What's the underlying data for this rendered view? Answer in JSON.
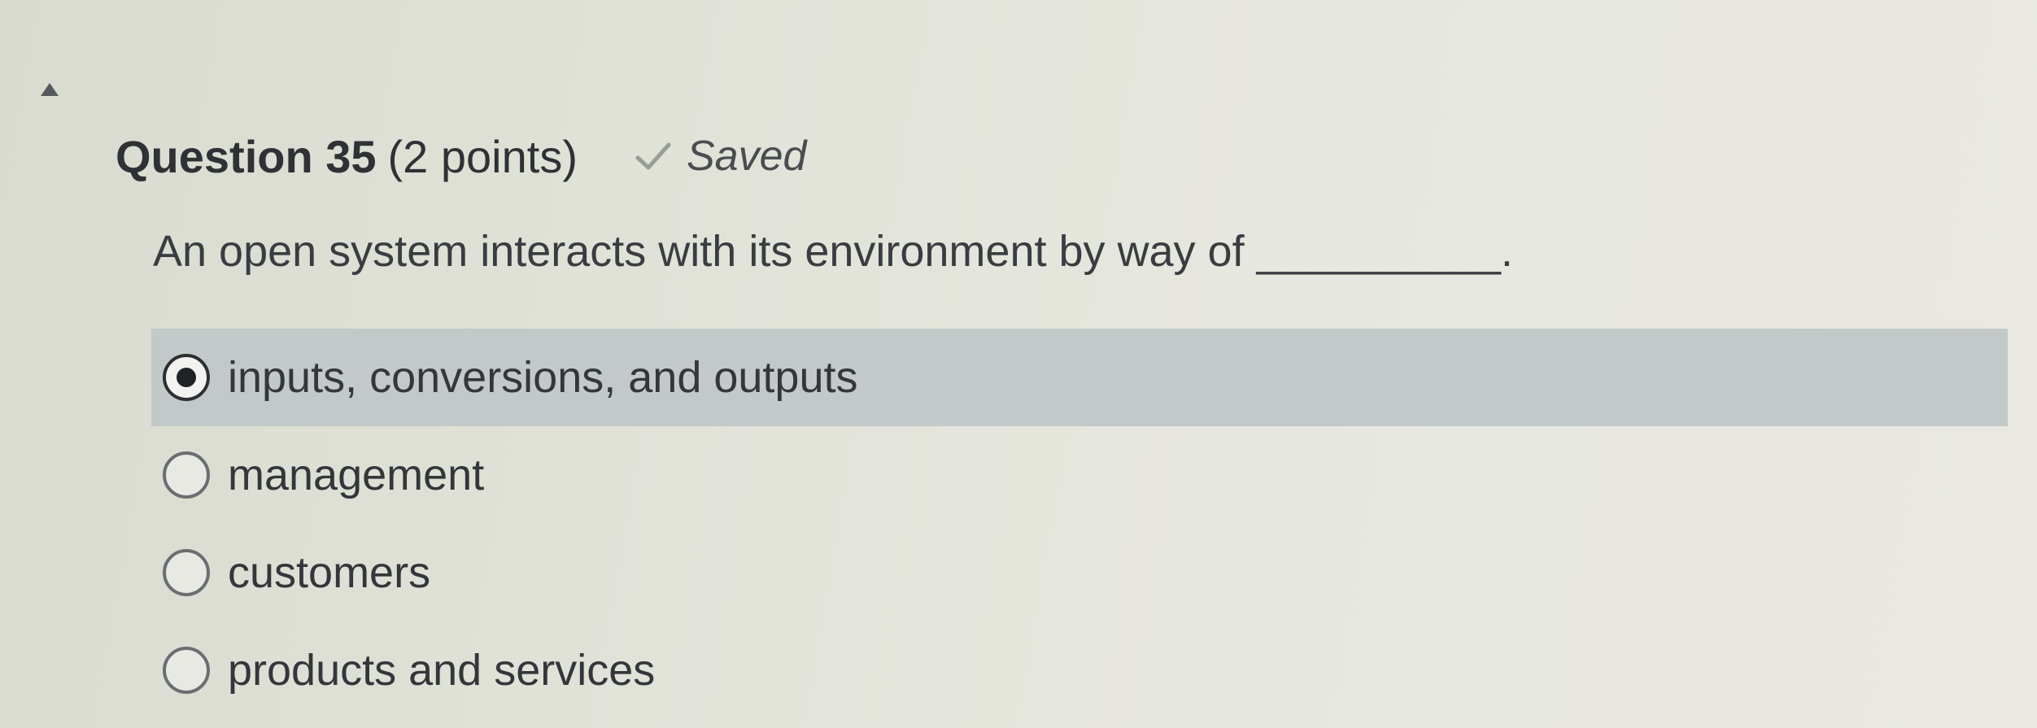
{
  "question": {
    "title": "Question 35",
    "points": "(2 points)",
    "status": "Saved",
    "prompt": "An open system interacts with its environment by way of __________."
  },
  "options": [
    {
      "label": "inputs, conversions, and outputs",
      "selected": true
    },
    {
      "label": "management",
      "selected": false
    },
    {
      "label": "customers",
      "selected": false
    },
    {
      "label": "products and services",
      "selected": false
    }
  ],
  "icons": {
    "collapse": "triangle-up-icon",
    "saved": "check-icon"
  },
  "colors": {
    "selected_row": "#c2c9c8",
    "text": "#34373a"
  }
}
